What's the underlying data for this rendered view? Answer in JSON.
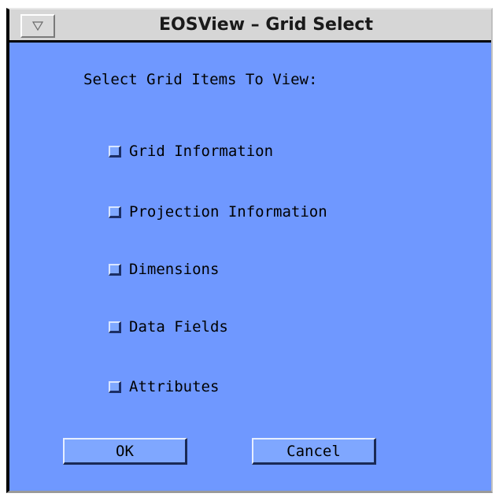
{
  "window": {
    "title": "EOSView – Grid Select"
  },
  "dialog": {
    "heading": "Select Grid Items To View:",
    "options": [
      {
        "label": "Grid Information",
        "checked": false
      },
      {
        "label": "Projection Information",
        "checked": false
      },
      {
        "label": "Dimensions",
        "checked": false
      },
      {
        "label": "Data Fields",
        "checked": false
      },
      {
        "label": "Attributes",
        "checked": false
      }
    ],
    "ok_label": "OK",
    "cancel_label": "Cancel"
  },
  "colors": {
    "dialog_background": "#6f98ff",
    "titlebar_background": "#d6d6d6"
  },
  "icons": {
    "window_menu": "triangle-down-icon"
  }
}
